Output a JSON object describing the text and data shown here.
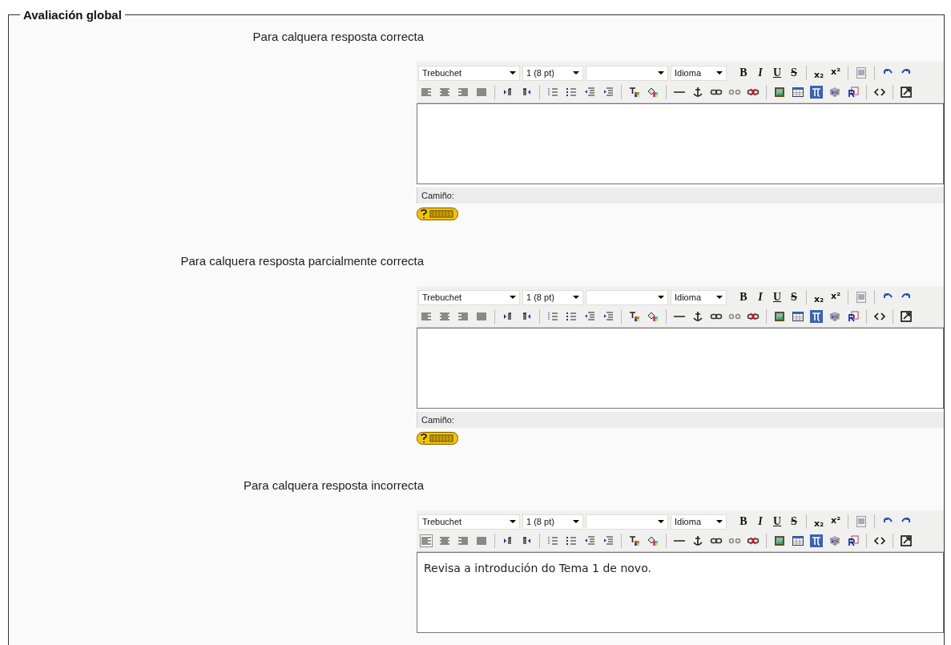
{
  "section": {
    "legend": "Avaliación global"
  },
  "editors": [
    {
      "label": "Para calquera resposta correcta",
      "font": "Trebuchet",
      "size": "1 (8 pt)",
      "language": "Idioma",
      "format_buttons": [
        {
          "kind": "bold",
          "glyph": "B"
        },
        {
          "kind": "italic",
          "glyph": "I"
        },
        {
          "kind": "underline",
          "glyph": "U"
        },
        {
          "kind": "strike",
          "glyph": "S"
        }
      ],
      "script_buttons": [
        {
          "kind": "sub",
          "glyph": "x₂"
        },
        {
          "kind": "sup",
          "glyph": "x²"
        }
      ],
      "align_left_selected": false,
      "path_label": "Camiño:"
    },
    {
      "label": "Para calquera resposta parcialmente correcta",
      "font": "Trebuchet",
      "size": "1 (8 pt)",
      "language": "Idioma",
      "format_buttons": [
        {
          "kind": "bold",
          "glyph": "B"
        },
        {
          "kind": "italic",
          "glyph": "I"
        },
        {
          "kind": "underline",
          "glyph": "U"
        },
        {
          "kind": "strike",
          "glyph": "S"
        }
      ],
      "script_buttons": [
        {
          "kind": "sub",
          "glyph": "x₂"
        },
        {
          "kind": "sup",
          "glyph": "x²"
        }
      ],
      "align_left_selected": false,
      "path_label": "Camiño:"
    },
    {
      "label": "Para calquera resposta incorrecta",
      "font": "Trebuchet",
      "size": "1 (8 pt)",
      "language": "Idioma",
      "format_buttons": [
        {
          "kind": "bold",
          "glyph": "B"
        },
        {
          "kind": "italic",
          "glyph": "I"
        },
        {
          "kind": "underline",
          "glyph": "U"
        },
        {
          "kind": "strike",
          "glyph": "S"
        }
      ],
      "script_buttons": [
        {
          "kind": "sub",
          "glyph": "x₂"
        },
        {
          "kind": "sup",
          "glyph": "x²"
        }
      ],
      "align_left_selected": true,
      "content": "Revisa a introdución do Tema 1 de novo."
    }
  ]
}
